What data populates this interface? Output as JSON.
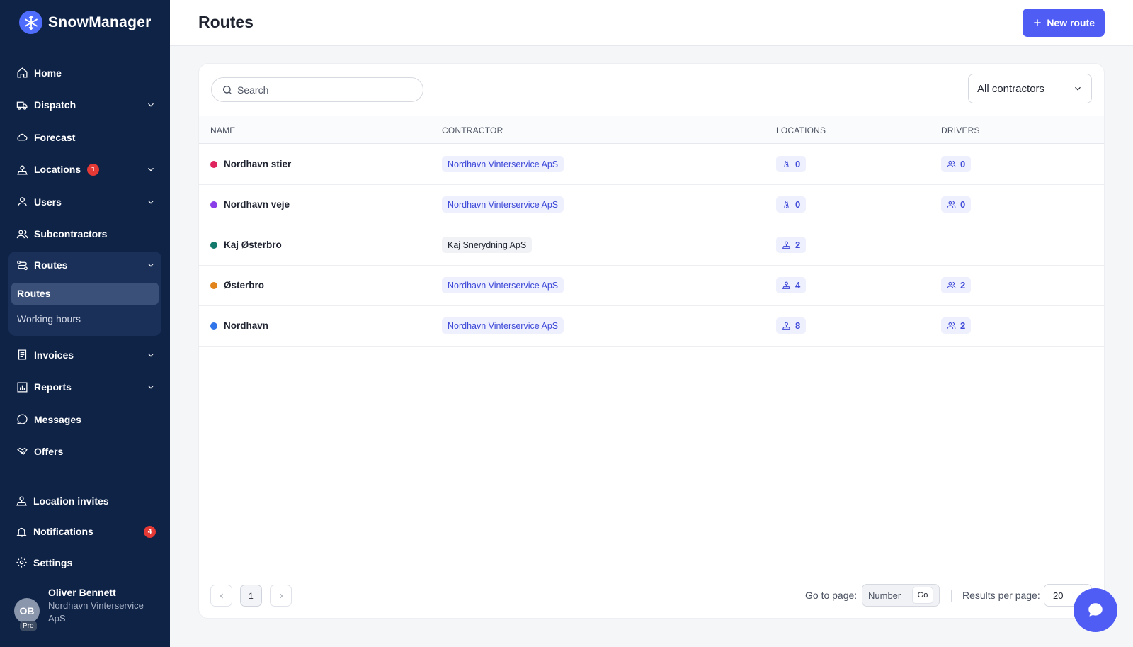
{
  "brand": {
    "name": "SnowManager"
  },
  "sidebar": {
    "items": [
      {
        "label": "Home",
        "icon": "home-icon"
      },
      {
        "label": "Dispatch",
        "icon": "truck-icon",
        "expandable": true
      },
      {
        "label": "Forecast",
        "icon": "cloud-icon"
      },
      {
        "label": "Locations",
        "icon": "location-pin-icon",
        "expandable": true,
        "badge": "1"
      },
      {
        "label": "Users",
        "icon": "user-icon",
        "expandable": true
      },
      {
        "label": "Subcontractors",
        "icon": "users-icon"
      }
    ],
    "routes_group": {
      "label": "Routes",
      "icon": "route-icon",
      "sub_items": [
        {
          "label": "Routes",
          "active": true
        },
        {
          "label": "Working hours",
          "active": false
        }
      ]
    },
    "items_after": [
      {
        "label": "Invoices",
        "icon": "invoice-icon",
        "expandable": true
      },
      {
        "label": "Reports",
        "icon": "chart-icon",
        "expandable": true
      },
      {
        "label": "Messages",
        "icon": "message-icon"
      },
      {
        "label": "Offers",
        "icon": "handshake-icon"
      }
    ],
    "bottom_items": [
      {
        "label": "Location invites",
        "icon": "location-invite-icon"
      },
      {
        "label": "Notifications",
        "icon": "bell-icon",
        "badge": "4"
      },
      {
        "label": "Settings",
        "icon": "gear-icon"
      }
    ],
    "user": {
      "initials": "OB",
      "plan": "Pro",
      "name": "Oliver Bennett",
      "company": "Nordhavn Vinterservice ApS"
    }
  },
  "header": {
    "title": "Routes",
    "new_button_label": "New route"
  },
  "filters": {
    "search_placeholder": "Search",
    "contractor_select": "All contractors"
  },
  "table": {
    "columns": [
      "NAME",
      "CONTRACTOR",
      "LOCATIONS",
      "DRIVERS"
    ],
    "rows": [
      {
        "name": "Nordhavn stier",
        "color": "#e0245e",
        "contractor": "Nordhavn Vinterservice ApS",
        "contractor_linked": true,
        "locations": "0",
        "locations_icon": "road-icon",
        "drivers": "0"
      },
      {
        "name": "Nordhavn veje",
        "color": "#8a3ee8",
        "contractor": "Nordhavn Vinterservice ApS",
        "contractor_linked": true,
        "locations": "0",
        "locations_icon": "road-icon",
        "drivers": "0"
      },
      {
        "name": "Kaj Østerbro",
        "color": "#137a6b",
        "contractor": "Kaj Snerydning ApS",
        "contractor_linked": false,
        "locations": "2",
        "locations_icon": "location-pin-icon",
        "drivers": ""
      },
      {
        "name": "Østerbro",
        "color": "#e0841b",
        "contractor": "Nordhavn Vinterservice ApS",
        "contractor_linked": true,
        "locations": "4",
        "locations_icon": "location-pin-icon",
        "drivers": "2"
      },
      {
        "name": "Nordhavn",
        "color": "#2f74e8",
        "contractor": "Nordhavn Vinterservice ApS",
        "contractor_linked": true,
        "locations": "8",
        "locations_icon": "location-pin-icon",
        "drivers": "2"
      }
    ]
  },
  "pagination": {
    "current_page": "1",
    "go_to_page_label": "Go to page:",
    "page_input_placeholder": "Number",
    "go_button": "Go",
    "results_per_page_label": "Results per page:",
    "results_per_page": "20"
  },
  "colors": {
    "sidebar_bg": "#0f2347",
    "accent": "#4f5df5",
    "badge_red": "#e53935"
  }
}
